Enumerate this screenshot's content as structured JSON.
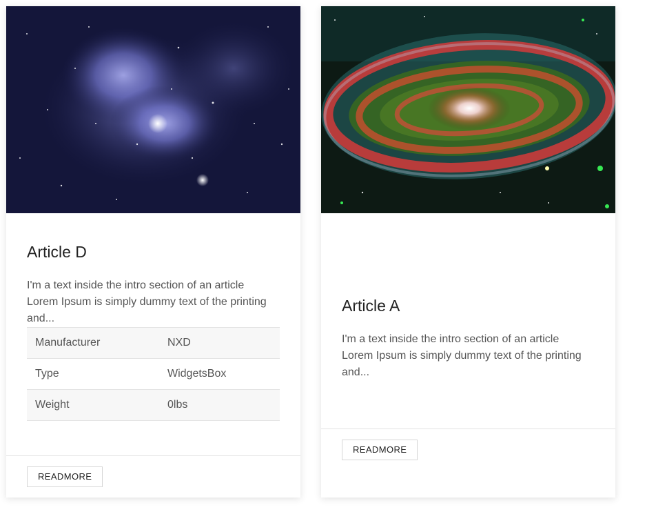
{
  "cards": [
    {
      "title": "Article D",
      "intro": "I'm a text inside the intro section of an article Lorem Ipsum is simply dummy text of the printing and...",
      "image_desc": "nebula-image",
      "specs": [
        {
          "label": "Manufacturer",
          "value": "NXD"
        },
        {
          "label": "Type",
          "value": "WidgetsBox"
        },
        {
          "label": "Weight",
          "value": "0lbs"
        }
      ],
      "button_label": "READMORE"
    },
    {
      "title": "Article A",
      "intro": "I'm a text inside the intro section of an article Lorem Ipsum is simply dummy text of the printing and...",
      "image_desc": "galaxy-image",
      "button_label": "READMORE"
    }
  ]
}
